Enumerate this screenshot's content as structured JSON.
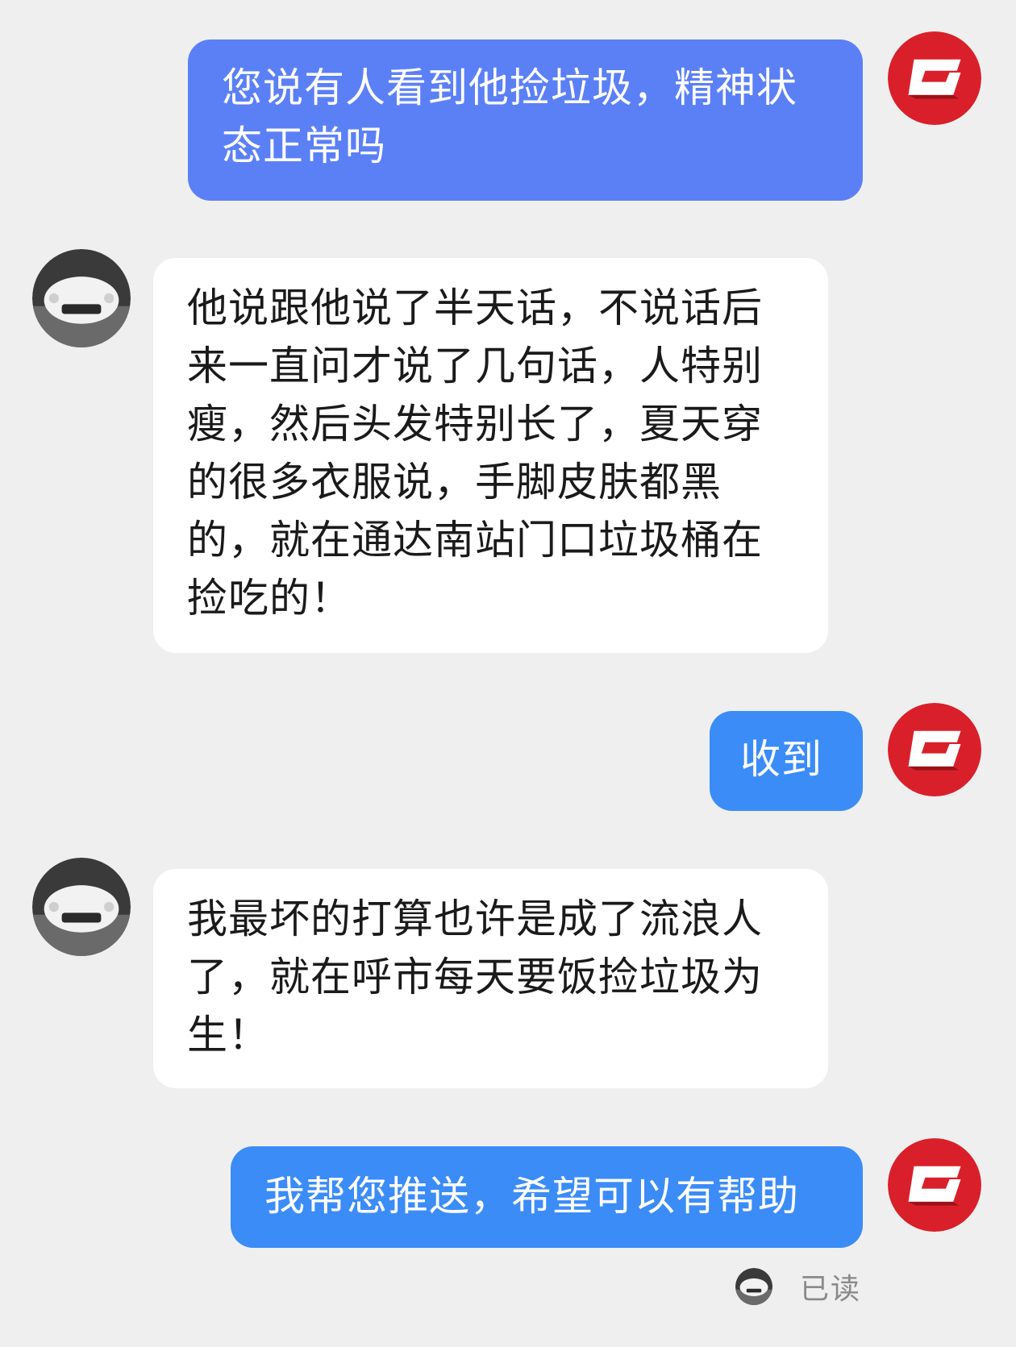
{
  "colors": {
    "background": "#efefef",
    "outgoing_bubble_lilac": "#5b80f6",
    "outgoing_bubble_blue": "#3b8cf7",
    "incoming_bubble": "#ffffff",
    "logo_red": "#d9202a"
  },
  "icons": {
    "self_avatar": "red-g-logo-icon",
    "contact_avatar": "white-car-photo-icon"
  },
  "messages": [
    {
      "direction": "outgoing",
      "text": "您说有人看到他捡垃圾，精神状态正常吗"
    },
    {
      "direction": "incoming",
      "text": "他说跟他说了半天话，不说话后来一直问才说了几句话，人特别瘦，然后头发特别长了，夏天穿的很多衣服说，手脚皮肤都黑的，就在通达南站门口垃圾桶在捡吃的！"
    },
    {
      "direction": "outgoing",
      "text": "收到"
    },
    {
      "direction": "incoming",
      "text": "我最坏的打算也许是成了流浪人了，就在呼市每天要饭捡垃圾为生！"
    },
    {
      "direction": "outgoing",
      "text": "我帮您推送，希望可以有帮助"
    }
  ],
  "read_receipt": {
    "label": "已读"
  }
}
